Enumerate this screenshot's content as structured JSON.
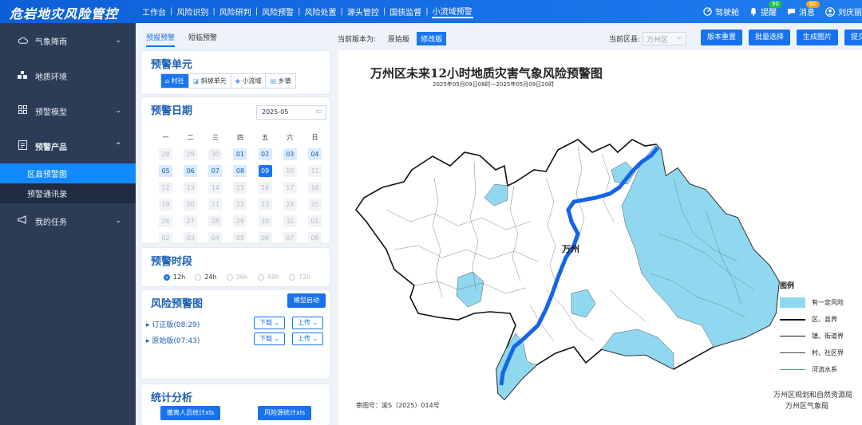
{
  "header": {
    "logo": "危岩地灾风险管控",
    "nav": [
      "工作台",
      "风险识别",
      "风险研判",
      "风险预警",
      "风险处置",
      "源头管控",
      "国债监督",
      "小流域预警"
    ],
    "active_nav": "小流域预警",
    "right": {
      "cockpit": "驾驶舱",
      "reminder": "提醒",
      "reminder_badge": "90",
      "message": "消息",
      "message_badge": "60",
      "user": "刘庆丽"
    }
  },
  "sidebar": {
    "items": [
      {
        "label": "气象降雨",
        "icon": "cloud-icon"
      },
      {
        "label": "地质环境",
        "icon": "terrain-icon"
      },
      {
        "label": "预警模型",
        "icon": "grid-icon"
      },
      {
        "label": "预警产品",
        "icon": "document-icon"
      },
      {
        "label": "我的任务",
        "icon": "megaphone-icon"
      }
    ],
    "sub_items": [
      "区县预警图",
      "预警通讯录"
    ],
    "active_sub": "区县预警图"
  },
  "toolbar": {
    "tab1": "预报预警",
    "tab2": "短临预警",
    "version_label": "当前版本为:",
    "version_original": "原始版",
    "version_modified": "修改版",
    "area_label": "当前区县:",
    "area_value": "万州区",
    "buttons": [
      "版本重置",
      "批量选择",
      "生成图片",
      "提交审核"
    ]
  },
  "unit_panel": {
    "title": "预警单元",
    "tabs": [
      "村社",
      "斜坡单元",
      "小流域",
      "乡镇"
    ]
  },
  "date_panel": {
    "title": "预警日期",
    "month": "2025-05",
    "weekdays": [
      "一",
      "二",
      "三",
      "四",
      "五",
      "六",
      "日"
    ],
    "rows": [
      [
        "28",
        "29",
        "30",
        "01",
        "02",
        "03",
        "04"
      ],
      [
        "05",
        "06",
        "07",
        "08",
        "09",
        "10",
        "11"
      ],
      [
        "12",
        "13",
        "14",
        "15",
        "16",
        "17",
        "18"
      ],
      [
        "19",
        "20",
        "21",
        "22",
        "23",
        "24",
        "25"
      ],
      [
        "26",
        "27",
        "28",
        "29",
        "30",
        "31",
        "01"
      ],
      [
        "02",
        "03",
        "04",
        "05",
        "06",
        "07",
        "08"
      ]
    ],
    "selected": "09"
  },
  "period_panel": {
    "title": "预警时段",
    "options": [
      "12h",
      "24h",
      "36h",
      "48h",
      "72h"
    ],
    "selected": "12h"
  },
  "risk_panel": {
    "title": "风险预警图",
    "start_button": "模型启动",
    "rows": [
      {
        "label": "订正版(08:29)",
        "download": "下载",
        "upload": "上传"
      },
      {
        "label": "原始版(07:43)",
        "download": "下载",
        "upload": "上传"
      }
    ]
  },
  "stats_panel": {
    "title": "统计分析",
    "buttons": [
      "撤离人员统计xls",
      "风险源统计xls"
    ]
  },
  "map": {
    "title": "万州区未来12小时地质灾害气象风险预警图",
    "subtitle": "2025年05月09日08时一2025年05月09日20时",
    "city_label": "万州",
    "legend_title": "图例",
    "legend": [
      "有一定风险",
      "区、县界",
      "镇、街道界",
      "村、社区界",
      "河流水系"
    ],
    "review_no": "审图号：渝S（2025）014号",
    "org1": "万州区规划和自然资源局",
    "org2": "万州区气象局",
    "risk_color": "#8fd8f0",
    "river_color": "#1565e8"
  }
}
